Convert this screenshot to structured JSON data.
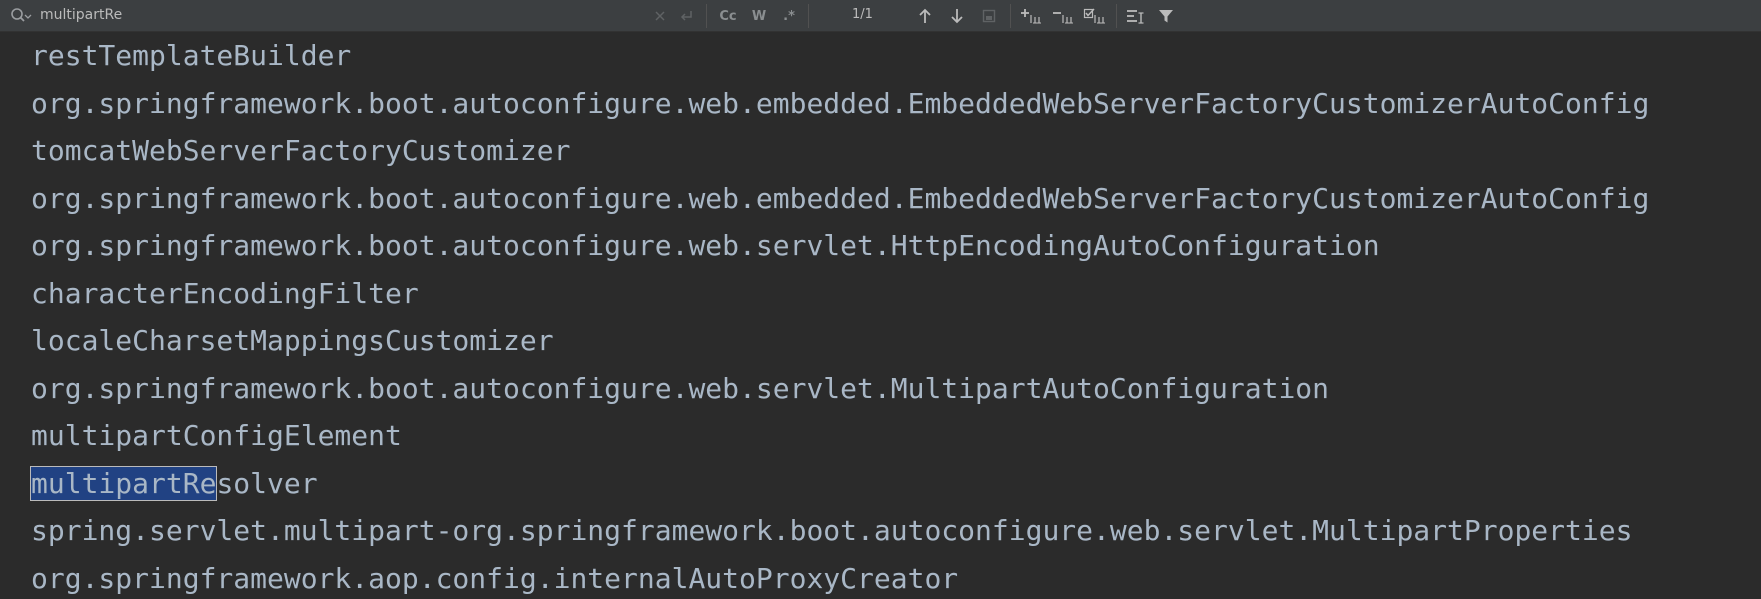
{
  "search": {
    "query": "multipartRe",
    "match_count": "1/1",
    "match_case_label": "Cc",
    "words_label": "W",
    "regex_label": ".*"
  },
  "editor": {
    "lines": [
      "restTemplateBuilder",
      "org.springframework.boot.autoconfigure.web.embedded.EmbeddedWebServerFactoryCustomizerAutoConfig",
      "tomcatWebServerFactoryCustomizer",
      "org.springframework.boot.autoconfigure.web.embedded.EmbeddedWebServerFactoryCustomizerAutoConfig",
      "org.springframework.boot.autoconfigure.web.servlet.HttpEncodingAutoConfiguration",
      "characterEncodingFilter",
      "localeCharsetMappingsCustomizer",
      "org.springframework.boot.autoconfigure.web.servlet.MultipartAutoConfiguration",
      "multipartConfigElement",
      "",
      "spring.servlet.multipart-org.springframework.boot.autoconfigure.web.servlet.MultipartProperties",
      "org.springframework.aop.config.internalAutoProxyCreator"
    ],
    "match_line": {
      "highlight": "multipartRe",
      "rest": "solver"
    }
  },
  "colors": {
    "background": "#2b2b2b",
    "toolbar": "#3c3f41",
    "text": "#a9b7c6",
    "match_highlight": "#214283"
  }
}
